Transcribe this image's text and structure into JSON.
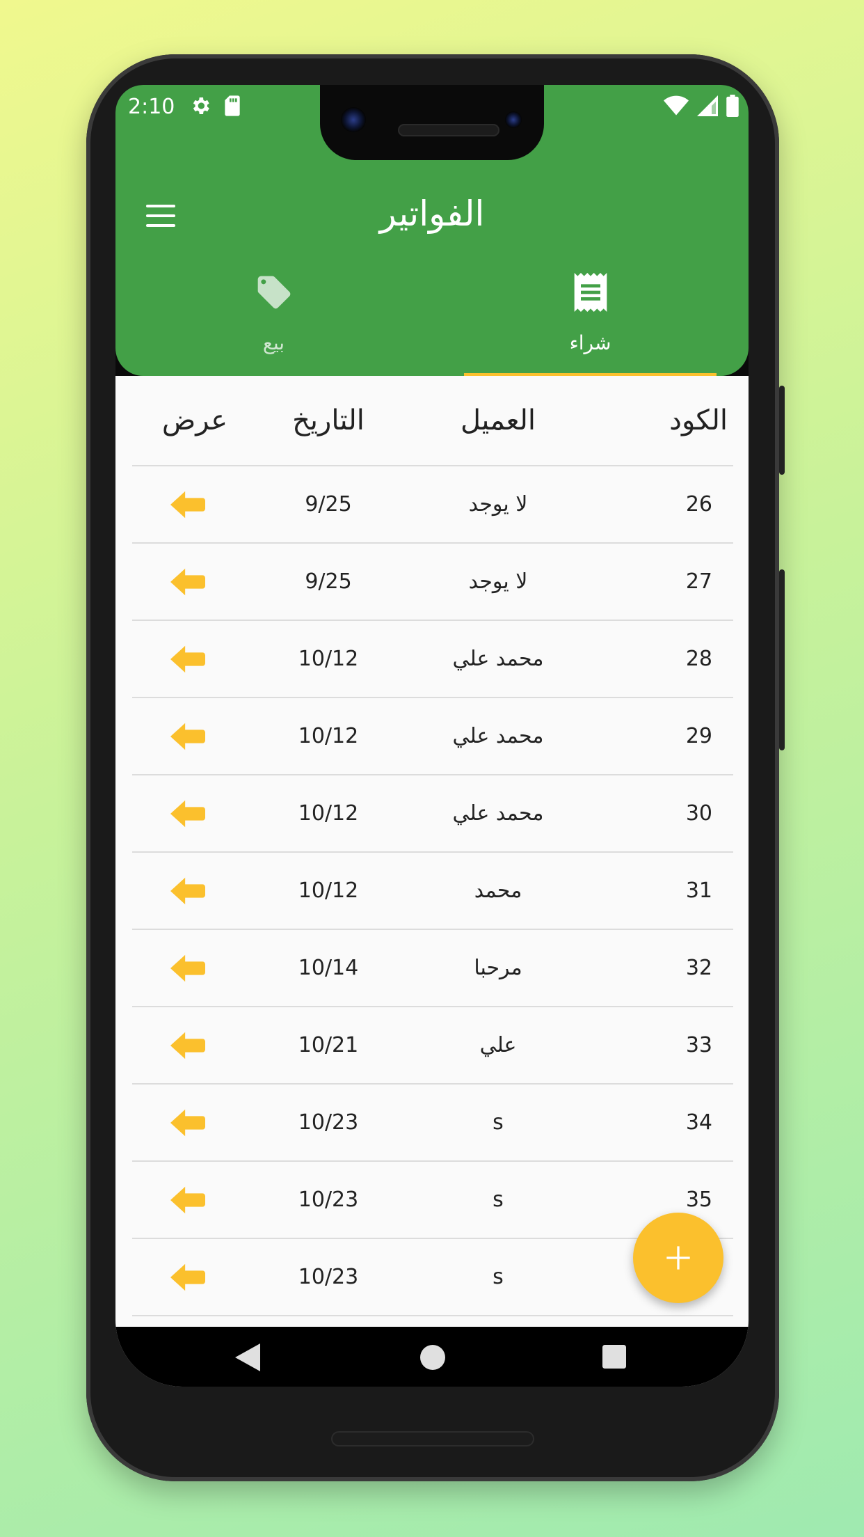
{
  "status_bar": {
    "time": "2:10",
    "left_icons": [
      "settings-icon",
      "sd-card-icon"
    ],
    "right_icons": [
      "wifi-icon",
      "signal-icon",
      "battery-icon"
    ]
  },
  "app_bar": {
    "title": "الفواتير",
    "menu_icon": "menu-icon",
    "color": "#43a047"
  },
  "tabs": [
    {
      "label": "شراء",
      "icon": "receipt-icon",
      "selected": true
    },
    {
      "label": "بيع",
      "icon": "tag-icon",
      "selected": false
    }
  ],
  "accent_color": "#fbc02d",
  "table": {
    "headers": {
      "code": "الكود",
      "client": "العميل",
      "date": "التاريخ",
      "view": "عرض"
    },
    "rows": [
      {
        "code": "26",
        "client": "لا يوجد",
        "date": "9/25"
      },
      {
        "code": "27",
        "client": "لا يوجد",
        "date": "9/25"
      },
      {
        "code": "28",
        "client": "محمد علي",
        "date": "10/12"
      },
      {
        "code": "29",
        "client": "محمد علي",
        "date": "10/12"
      },
      {
        "code": "30",
        "client": "محمد علي",
        "date": "10/12"
      },
      {
        "code": "31",
        "client": "محمد",
        "date": "10/12"
      },
      {
        "code": "32",
        "client": "مرحبا",
        "date": "10/14"
      },
      {
        "code": "33",
        "client": "علي",
        "date": "10/21"
      },
      {
        "code": "34",
        "client": "s",
        "date": "10/23"
      },
      {
        "code": "35",
        "client": "s",
        "date": "10/23"
      },
      {
        "code": "",
        "client": "s",
        "date": "10/23"
      }
    ],
    "row_action_icon": "arrow-left-icon"
  },
  "fab": {
    "icon": "plus-icon"
  },
  "nav_bar": {
    "buttons": [
      "back-icon",
      "home-icon",
      "recents-icon"
    ]
  }
}
